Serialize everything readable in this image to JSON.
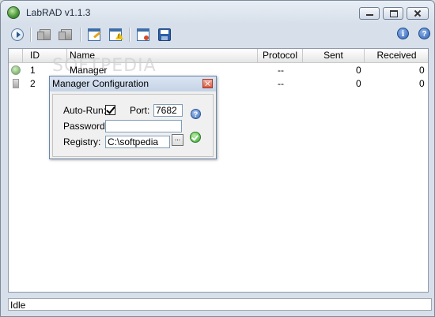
{
  "window": {
    "title": "LabRAD v1.1.3",
    "icon": "labrad-globe-icon"
  },
  "toolbar": {
    "buttons": [
      {
        "name": "play-icon"
      },
      {
        "name": "server-icon"
      },
      {
        "name": "server-icon"
      },
      {
        "name": "edit-document-icon"
      },
      {
        "name": "warning-document-icon"
      },
      {
        "name": "document-red-icon"
      },
      {
        "name": "save-icon"
      }
    ],
    "info_glyph": "i",
    "help_glyph": "?"
  },
  "list": {
    "columns": [
      "ID",
      "Name",
      "Protocol",
      "Sent",
      "Received"
    ],
    "watermark": "SOFTPEDIA",
    "rows": [
      {
        "id": "1",
        "name": "Manager",
        "protocol": "--",
        "sent": "0",
        "received": "0",
        "icon": "globe-icon"
      },
      {
        "id": "2",
        "name": "",
        "protocol": "--",
        "sent": "0",
        "received": "0",
        "icon": "server-icon"
      }
    ]
  },
  "dialog": {
    "title": "Manager Configuration",
    "autorun_label": "Auto-Run:",
    "autorun_checked": true,
    "port_label": "Port:",
    "port_value": "7682",
    "password_label": "Password:",
    "password_value": "",
    "registry_label": "Registry:",
    "registry_value": "C:\\softpedia",
    "browse_label": "...",
    "help_glyph": "?"
  },
  "status": {
    "text": "Idle"
  },
  "colors": {
    "titlebar": "#d6dfea",
    "accent": "#2d5fa7"
  }
}
